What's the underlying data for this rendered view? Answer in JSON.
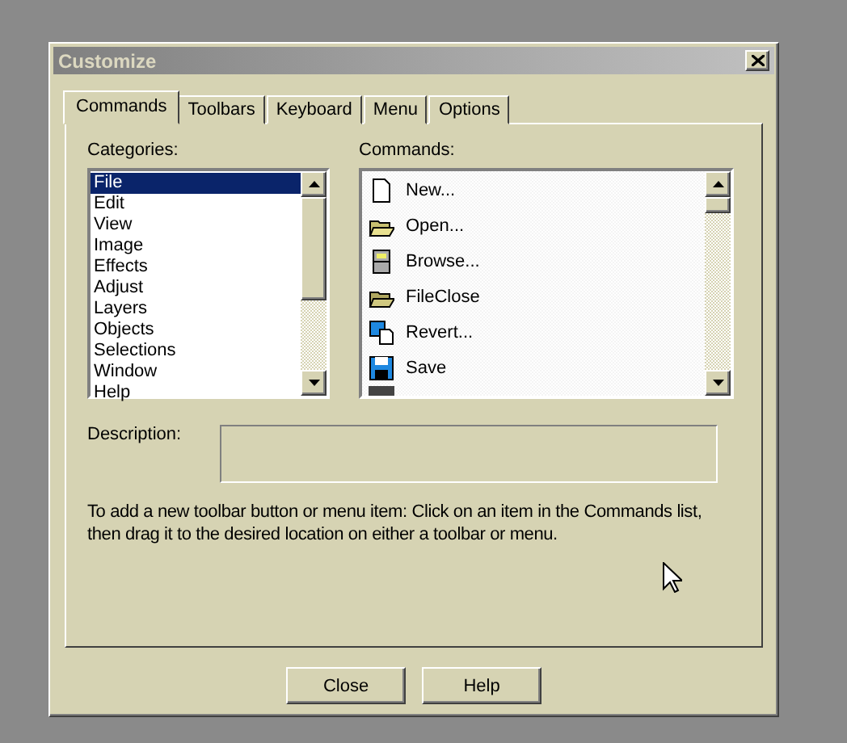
{
  "window": {
    "title": "Customize"
  },
  "tabs": [
    {
      "label": "Commands",
      "selected": true
    },
    {
      "label": "Toolbars",
      "selected": false
    },
    {
      "label": "Keyboard",
      "selected": false
    },
    {
      "label": "Menu",
      "selected": false
    },
    {
      "label": "Options",
      "selected": false
    }
  ],
  "categories": {
    "label": "Categories:",
    "items": [
      {
        "label": "File",
        "selected": true
      },
      {
        "label": "Edit",
        "selected": false
      },
      {
        "label": "View",
        "selected": false
      },
      {
        "label": "Image",
        "selected": false
      },
      {
        "label": "Effects",
        "selected": false
      },
      {
        "label": "Adjust",
        "selected": false
      },
      {
        "label": "Layers",
        "selected": false
      },
      {
        "label": "Objects",
        "selected": false
      },
      {
        "label": "Selections",
        "selected": false
      },
      {
        "label": "Window",
        "selected": false
      },
      {
        "label": "Help",
        "selected": false
      }
    ]
  },
  "commands": {
    "label": "Commands:",
    "items": [
      {
        "label": "New..."
      },
      {
        "label": "Open..."
      },
      {
        "label": "Browse..."
      },
      {
        "label": "FileClose"
      },
      {
        "label": "Revert..."
      },
      {
        "label": "Save"
      }
    ]
  },
  "description": {
    "label": "Description:"
  },
  "hint": "To add a new toolbar button or menu item:  Click on an item in the Commands list, then drag it to the desired location on either a toolbar or menu.",
  "buttons": [
    "Close",
    "Help"
  ]
}
